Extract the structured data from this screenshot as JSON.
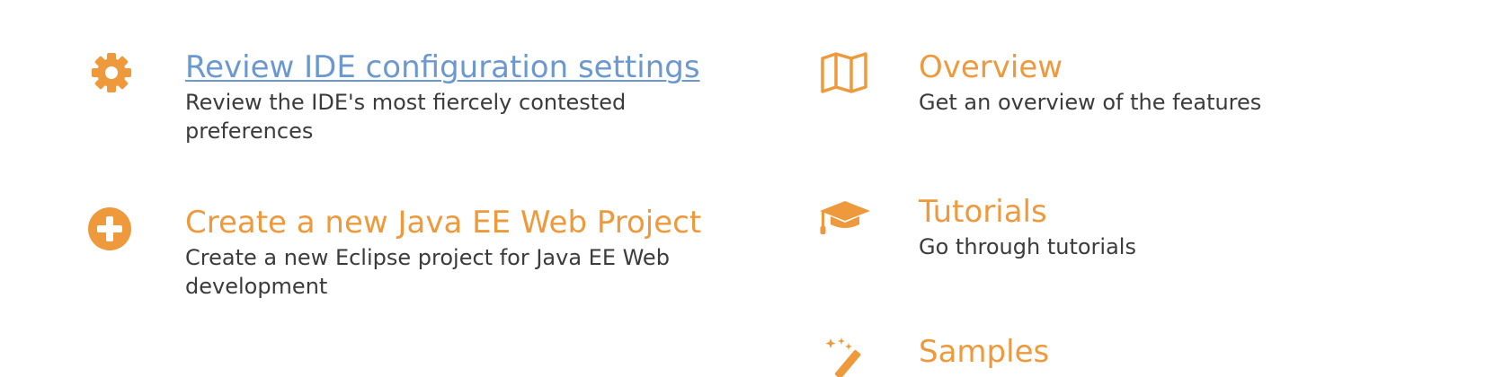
{
  "colors": {
    "accent": "#EE9A3C",
    "link": "#6B98D0",
    "text": "#3b3b3b",
    "background": "#ffffff"
  },
  "left_column": {
    "items": [
      {
        "icon": "gear-icon",
        "title": "Review IDE configuration settings",
        "description": "Review the IDE's most fiercely contested preferences"
      },
      {
        "icon": "plus-circle-icon",
        "title": "Create a new Java EE Web Project",
        "description": "Create a new Eclipse project for Java EE Web development"
      }
    ]
  },
  "right_column": {
    "items": [
      {
        "icon": "map-icon",
        "title": "Overview",
        "description": "Get an overview of the features"
      },
      {
        "icon": "graduation-cap-icon",
        "title": "Tutorials",
        "description": "Go through tutorials"
      },
      {
        "icon": "magic-wand-icon",
        "title": "Samples",
        "description": ""
      }
    ]
  }
}
